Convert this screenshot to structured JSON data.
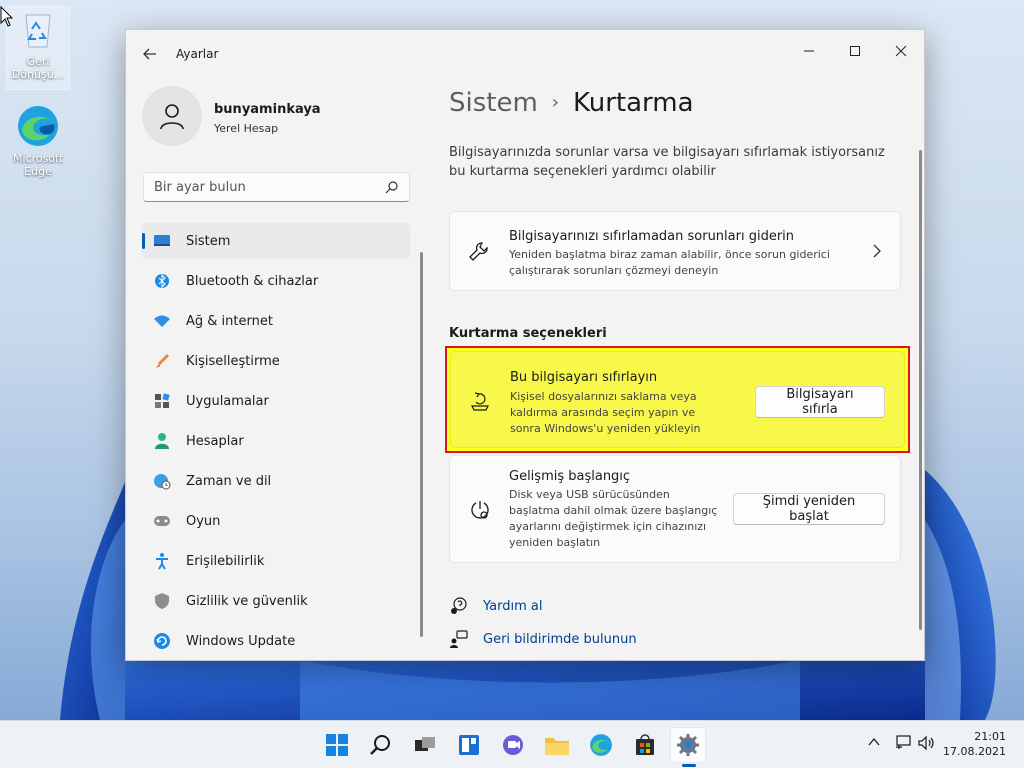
{
  "desktop": {
    "icons": [
      {
        "label": "Geri\nDönüşü..."
      },
      {
        "label": "Microsoft\nEdge"
      }
    ]
  },
  "window": {
    "app_title": "Ayarlar"
  },
  "profile": {
    "name": "bunyaminkaya",
    "account_type": "Yerel Hesap"
  },
  "search": {
    "placeholder": "Bir ayar bulun"
  },
  "sidebar": {
    "items": [
      {
        "label": "Sistem",
        "icon": "monitor-icon",
        "active": true
      },
      {
        "label": "Bluetooth & cihazlar",
        "icon": "bluetooth-icon"
      },
      {
        "label": "Ağ & internet",
        "icon": "wifi-icon"
      },
      {
        "label": "Kişiselleştirme",
        "icon": "brush-icon"
      },
      {
        "label": "Uygulamalar",
        "icon": "apps-icon"
      },
      {
        "label": "Hesaplar",
        "icon": "person-icon"
      },
      {
        "label": "Zaman ve dil",
        "icon": "globe-clock-icon"
      },
      {
        "label": "Oyun",
        "icon": "gamepad-icon"
      },
      {
        "label": "Erişilebilirlik",
        "icon": "accessibility-icon"
      },
      {
        "label": "Gizlilik ve güvenlik",
        "icon": "shield-icon"
      },
      {
        "label": "Windows Update",
        "icon": "update-icon"
      }
    ]
  },
  "content": {
    "breadcrumb": {
      "parent": "Sistem",
      "separator": "›",
      "current": "Kurtarma"
    },
    "description": "Bilgisayarınızda sorunlar varsa ve bilgisayarı sıfırlamak istiyorsanız bu kurtarma seçenekleri yardımcı olabilir",
    "troubleshoot_card": {
      "title": "Bilgisayarınızı sıfırlamadan sorunları giderin",
      "subtitle": "Yeniden başlatma biraz zaman alabilir, önce sorun giderici çalıştırarak sorunları çözmeyi deneyin"
    },
    "section_title": "Kurtarma seçenekleri",
    "reset_card": {
      "title": "Bu bilgisayarı sıfırlayın",
      "subtitle": "Kişisel dosyalarınızı saklama veya kaldırma arasında seçim yapın ve sonra Windows'u yeniden yükleyin",
      "button": "Bilgisayarı sıfırla"
    },
    "advanced_card": {
      "title": "Gelişmiş başlangıç",
      "subtitle": "Disk veya USB sürücüsünden başlatma dahil olmak üzere başlangıç ayarlarını değiştirmek için cihazınızı yeniden başlatın",
      "button": "Şimdi yeniden başlat"
    },
    "links": [
      {
        "label": "Yardım al"
      },
      {
        "label": "Geri bildirimde bulunun"
      }
    ]
  },
  "taskbar": {
    "time": "21:01",
    "date": "17.08.2021"
  },
  "colors": {
    "accent": "#005fb8",
    "highlight_fill": "#ffff20",
    "highlight_border": "#d4191e",
    "link": "#003e92"
  }
}
